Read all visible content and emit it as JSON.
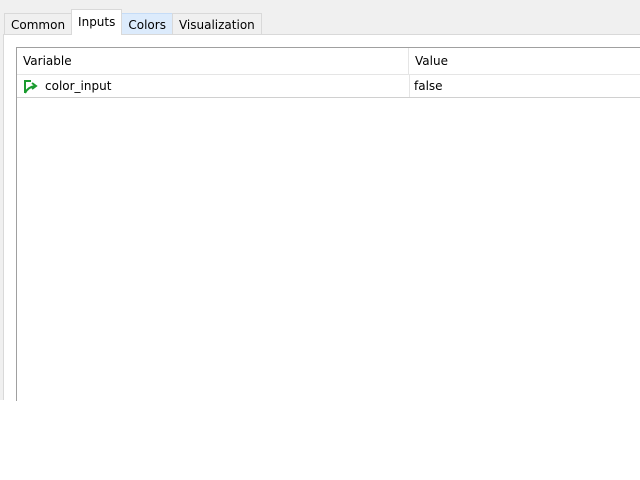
{
  "tabs": [
    {
      "label": "Common"
    },
    {
      "label": "Inputs"
    },
    {
      "label": "Colors"
    },
    {
      "label": "Visualization"
    }
  ],
  "active_tab": "Inputs",
  "table": {
    "headers": {
      "variable": "Variable",
      "value": "Value"
    },
    "rows": [
      {
        "variable": "color_input",
        "value": "false",
        "icon": "input-variable-icon"
      }
    ]
  },
  "colors": {
    "icon_green": "#1a9b2f",
    "hover_tab": "#dcebfc"
  }
}
